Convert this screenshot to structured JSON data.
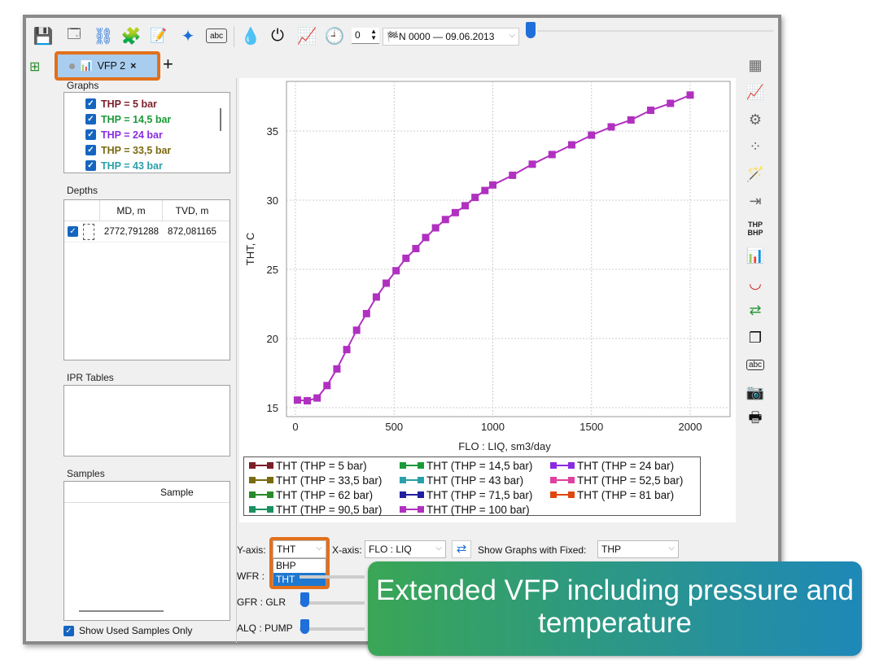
{
  "toolbar": {
    "icons": [
      "save-icon",
      "new-window-icon",
      "workflow-icon",
      "puzzle-icon",
      "edit-document-icon",
      "sparkle-icon",
      "abc-comment-icon",
      "drop-icon",
      "plug-icon",
      "vfp-chart-icon",
      "clock-edit-icon"
    ],
    "spin_value": "0",
    "step_select": "N 0000 — 09.06.2013"
  },
  "tabs": [
    {
      "label": "VFP 2",
      "close": "×"
    }
  ],
  "add_tab": "+",
  "left": {
    "graphs_title": "Graphs",
    "graphs": [
      {
        "label": "THP = 5 bar",
        "color": "#7b1f2a"
      },
      {
        "label": "THP = 14,5 bar",
        "color": "#1a9a3a"
      },
      {
        "label": "THP = 24 bar",
        "color": "#8a2be2"
      },
      {
        "label": "THP = 33,5 bar",
        "color": "#7a6a10"
      },
      {
        "label": "THP = 43 bar",
        "color": "#2aa0a8"
      }
    ],
    "depths_title": "Depths",
    "depths_cols": [
      "MD, m",
      "TVD, m"
    ],
    "depths_rows": [
      [
        "2772,791288",
        "872,081165"
      ]
    ],
    "ipr_title": "IPR Tables",
    "samples_title": "Samples",
    "samples_col": "Sample",
    "show_used": "Show Used Samples Only"
  },
  "chart_data": {
    "type": "line",
    "xlabel": "FLO : LIQ, sm3/day",
    "ylabel": "THT, C",
    "xlim": [
      -50,
      2050
    ],
    "ylim": [
      14.4,
      38.4
    ],
    "xticks": [
      0,
      500,
      1000,
      1500,
      2000
    ],
    "yticks": [
      15,
      20,
      25,
      30,
      35
    ],
    "grid": true,
    "legend": "bottom",
    "x": [
      10,
      60,
      110,
      160,
      210,
      260,
      310,
      360,
      410,
      460,
      510,
      560,
      610,
      660,
      710,
      760,
      810,
      860,
      910,
      960,
      1000,
      1100,
      1200,
      1300,
      1400,
      1500,
      1600,
      1700,
      1800,
      1900,
      2000
    ],
    "series": [
      {
        "name": "THT (THP = 100 bar)",
        "color": "#b030c0",
        "values": [
          15.55,
          15.5,
          15.7,
          16.6,
          17.8,
          19.2,
          20.6,
          21.8,
          23.0,
          24.0,
          24.9,
          25.8,
          26.5,
          27.3,
          28.0,
          28.6,
          29.1,
          29.6,
          30.2,
          30.7,
          31.1,
          31.8,
          32.6,
          33.3,
          34.0,
          34.7,
          35.3,
          35.8,
          36.5,
          37.0,
          37.6
        ]
      }
    ],
    "legend_entries": [
      {
        "name": "THT (THP = 5 bar)",
        "color": "#7b1f2a"
      },
      {
        "name": "THT (THP = 14,5 bar)",
        "color": "#1a9a3a"
      },
      {
        "name": "THT (THP = 24 bar)",
        "color": "#8a2be2"
      },
      {
        "name": "THT (THP = 33,5 bar)",
        "color": "#7a6a10"
      },
      {
        "name": "THT (THP = 43 bar)",
        "color": "#2aa0a8"
      },
      {
        "name": "THT (THP = 52,5 bar)",
        "color": "#e040a0"
      },
      {
        "name": "THT (THP = 62 bar)",
        "color": "#2a8a2a"
      },
      {
        "name": "THT (THP = 71,5 bar)",
        "color": "#2020a0"
      },
      {
        "name": "THT (THP = 81 bar)",
        "color": "#e04810"
      },
      {
        "name": "THT (THP = 90,5 bar)",
        "color": "#1a9060"
      },
      {
        "name": "THT (THP = 100 bar)",
        "color": "#b030c0"
      }
    ]
  },
  "controls": {
    "y_axis_label": "Y-axis:",
    "y_axis_value": "THT",
    "y_options": [
      "BHP",
      "THT"
    ],
    "x_axis_label": "X-axis:",
    "x_axis_value": "FLO : LIQ",
    "fixed_label": "Show Graphs with Fixed:",
    "fixed_value": "THP",
    "wfr": "WFR :",
    "gfr": "GFR : GLR",
    "alq": "ALQ : PUMP"
  },
  "right_toolbar": [
    "table-chart-icon",
    "scatter-line-icon",
    "chart-settings-icon",
    "scatter-icon",
    "magic-table-icon",
    "import-table-icon",
    "thp-bhp-icon",
    "shift-curves-icon",
    "u-curve-icon",
    "swap-arrows-icon",
    "copy-icon",
    "abc-comment-icon",
    "camera-icon",
    "print-icon"
  ],
  "right_toolbar_text": {
    "thp": "THP",
    "bhp": "BHP",
    "abc": "abc"
  },
  "banner": {
    "text": "Extended VFP including pressure and temperature",
    "colors": [
      "#3aa655",
      "#1e88b8"
    ]
  }
}
